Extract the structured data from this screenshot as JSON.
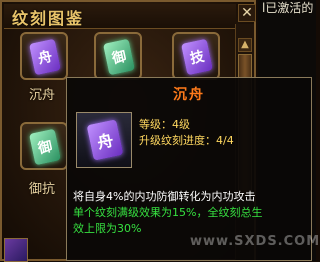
{
  "window": {
    "title": "纹刻图鉴",
    "close": "✕"
  },
  "side_text": "l已激活的",
  "slots": [
    {
      "label": "沉舟",
      "rune": "舟",
      "color": "purple"
    },
    {
      "label": "",
      "rune": "御",
      "color": "green"
    },
    {
      "label": "",
      "rune": "技",
      "color": "purple"
    },
    {
      "label": "御抗",
      "rune": "御",
      "color": "green"
    }
  ],
  "tooltip": {
    "title": "沉舟",
    "icon_glyph": "舟",
    "level": "等级：4级",
    "progress": "升级纹刻进度：4/4",
    "desc1": "将自身4%的内功防御转化为内功攻击",
    "desc2": "单个纹刻满级效果为15%，全纹刻总生",
    "desc3": "效上限为30%"
  },
  "watermark": "www.SXDS.COM",
  "colors": {
    "title": "#e8c46a",
    "tooltip_title": "#ff7a1a",
    "stat": "#ffd860",
    "green": "#36e040"
  }
}
